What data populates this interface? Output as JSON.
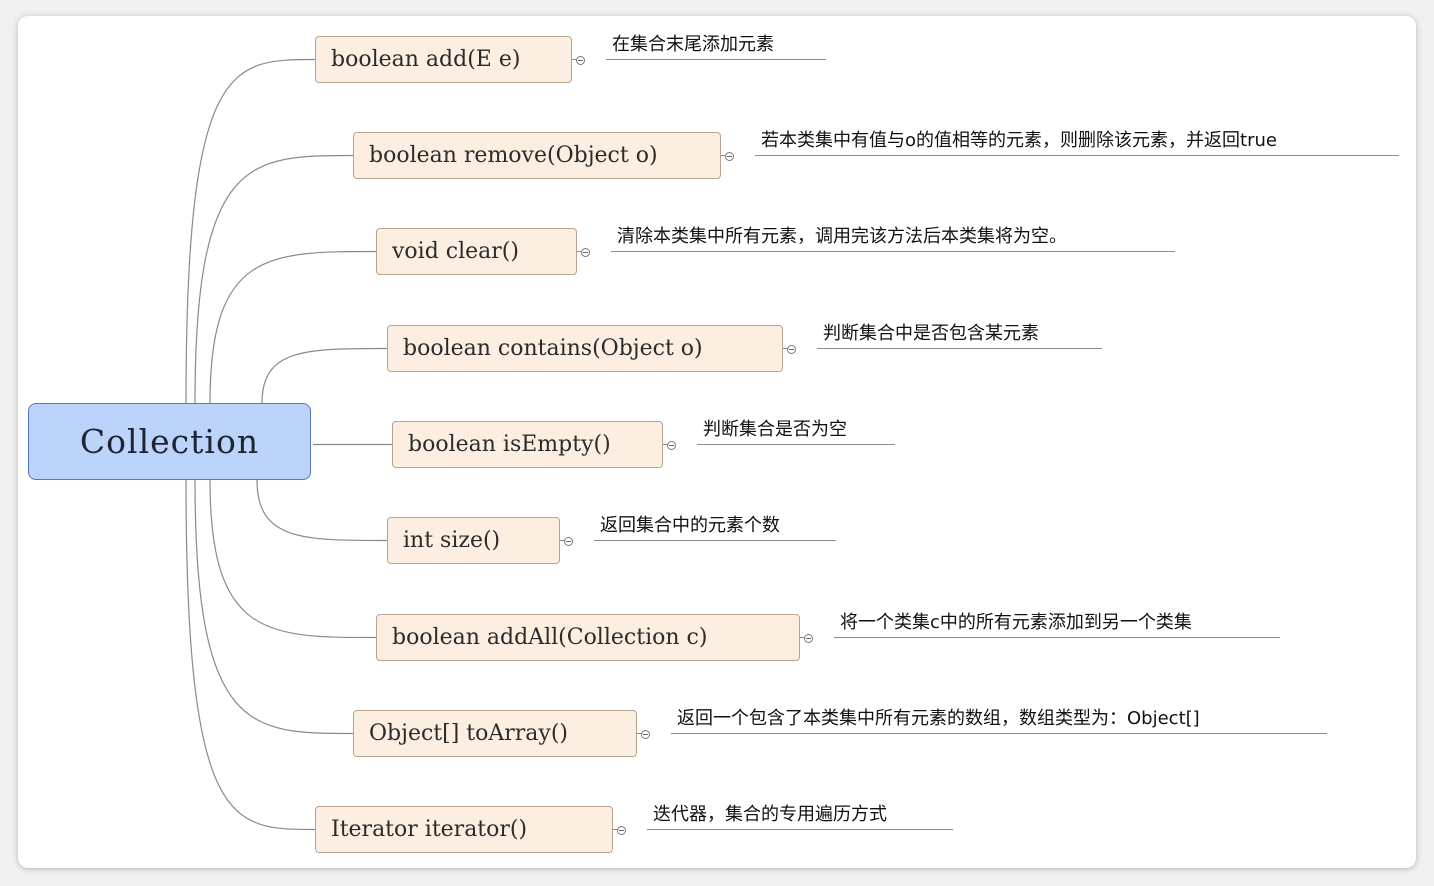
{
  "root": {
    "label": "Collection"
  },
  "methods": [
    {
      "signature": "boolean add(E e)",
      "note": "在集合末尾添加元素"
    },
    {
      "signature": "boolean remove(Object o)",
      "note": "若本类集中有值与o的值相等的元素，则删除该元素，并返回true"
    },
    {
      "signature": "void clear()",
      "note": "清除本类集中所有元素，调用完该方法后本类集将为空。"
    },
    {
      "signature": "boolean contains(Object o)",
      "note": "判断集合中是否包含某元素"
    },
    {
      "signature": "boolean isEmpty()",
      "note": "判断集合是否为空"
    },
    {
      "signature": "int size()",
      "note": "返回集合中的元素个数"
    },
    {
      "signature": "boolean addAll(Collection c)",
      "note": "将一个类集c中的所有元素添加到另一个类集"
    },
    {
      "signature": "Object[] toArray()",
      "note": "返回一个包含了本类集中所有元素的数组，数组类型为：Object[]"
    },
    {
      "signature": "Iterator iterator()",
      "note": "迭代器，集合的专用遍历方式"
    }
  ],
  "colors": {
    "root_fill": "#bcd4fb",
    "root_border": "#5576b8",
    "node_fill": "#fcefe2",
    "node_border": "#b8a391",
    "connector": "#8a8a8a"
  }
}
